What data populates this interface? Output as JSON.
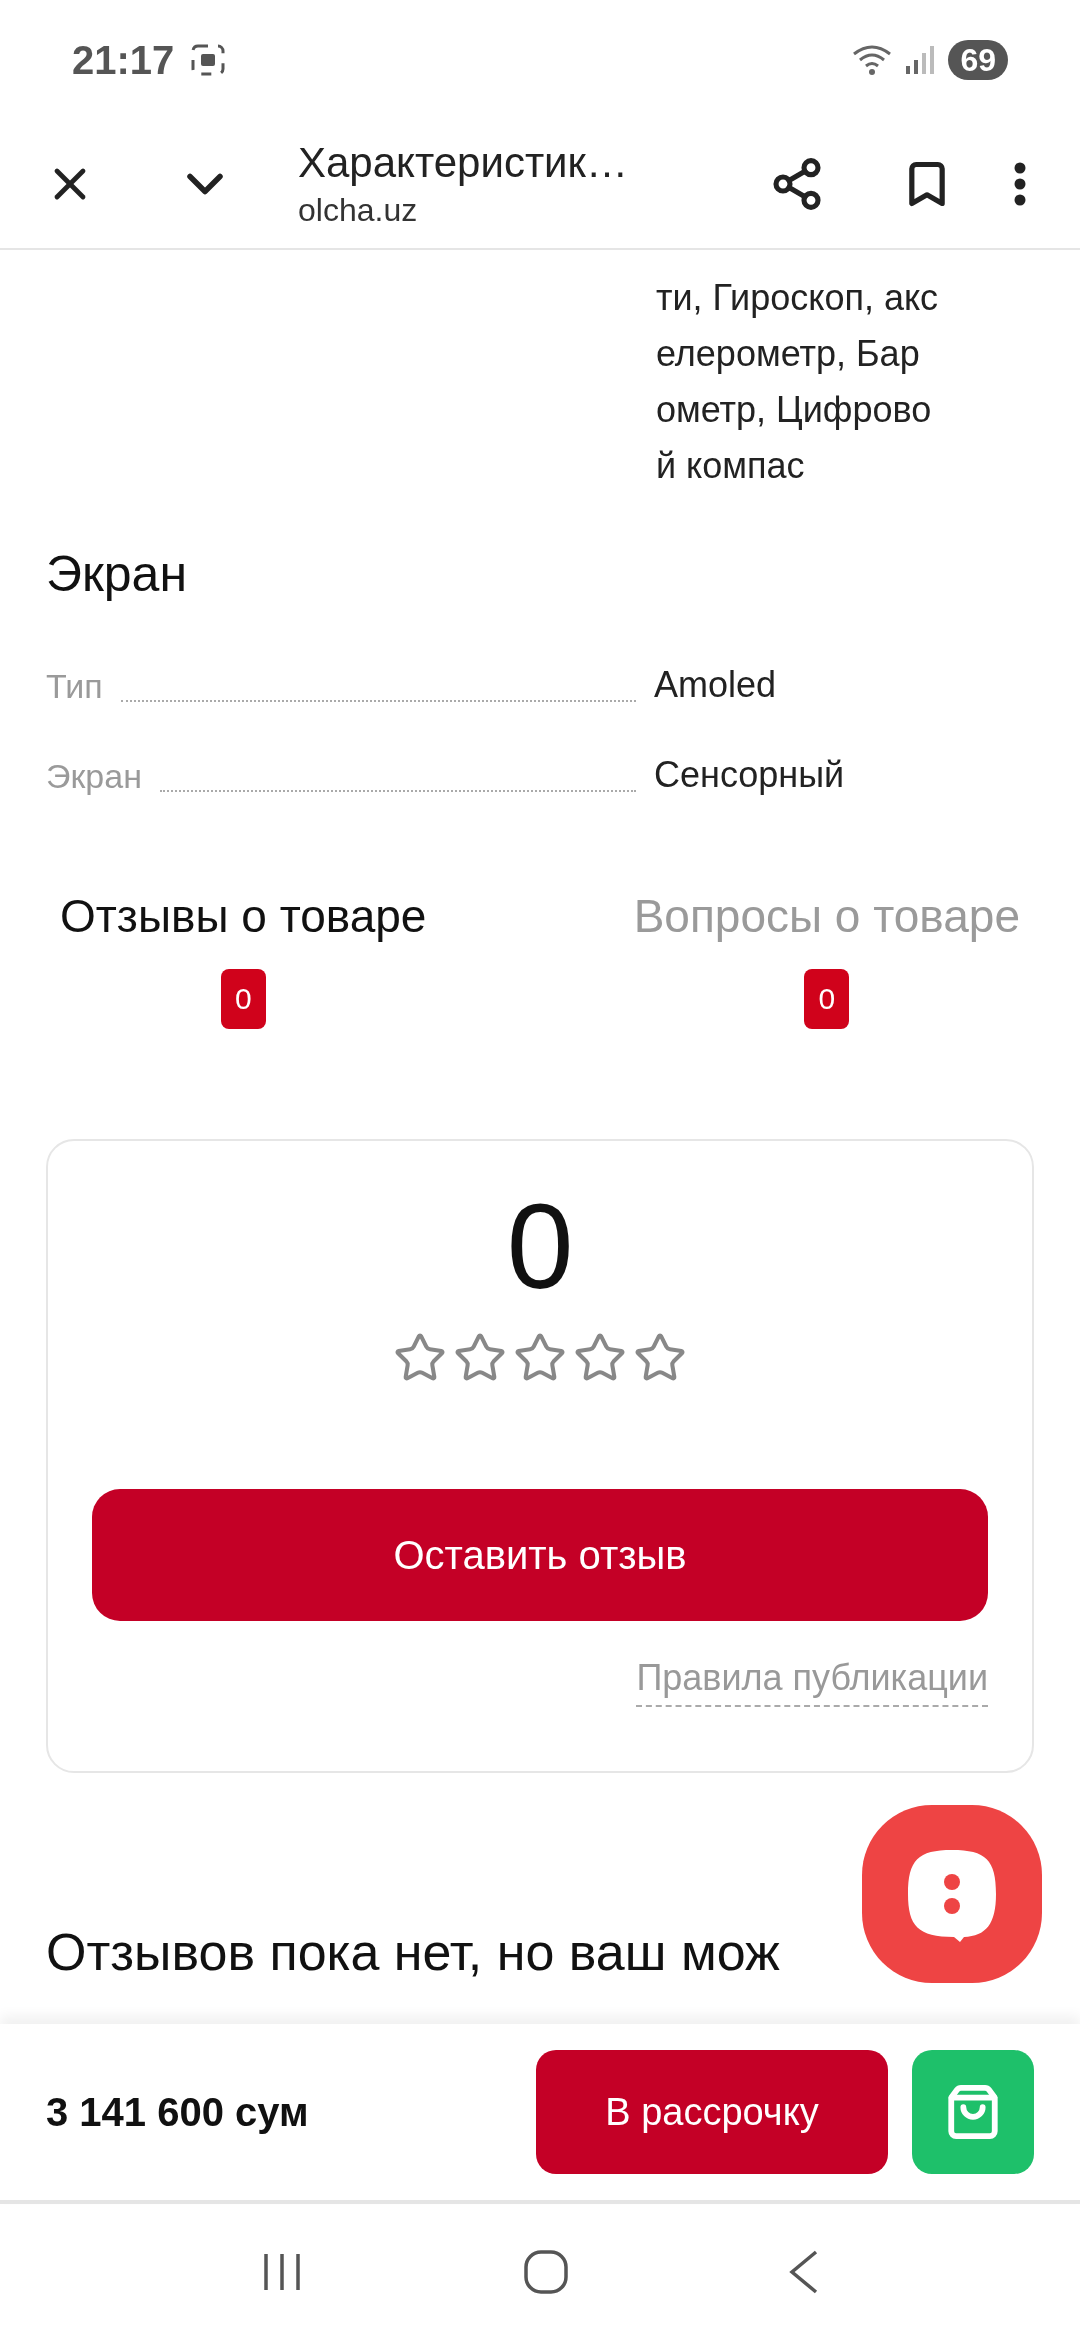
{
  "status_bar": {
    "time": "21:17",
    "battery": "69"
  },
  "browser_bar": {
    "title": "Характеристик…",
    "url": "olcha.uz"
  },
  "spec_continuation": "ти, Гироскоп, акс\nелерометр, Бар\nометр, Цифрово\nй компас",
  "section": {
    "title": "Экран",
    "rows": [
      {
        "label": "Тип",
        "value": "Amoled"
      },
      {
        "label": "Экран",
        "value": "Сенсорный"
      }
    ]
  },
  "tabs": [
    {
      "label": "Отзывы о товаре",
      "count": "0",
      "selected": true
    },
    {
      "label": "Вопросы о товаре",
      "count": "0",
      "selected": false
    }
  ],
  "rating_card": {
    "score": "0",
    "stars": 0,
    "button": "Оставить отзыв",
    "rules_link": "Правила публикации"
  },
  "reviews_heading": "Отзывов пока нет, но ваш мож",
  "bottom_bar": {
    "price": "3 141 600 сум",
    "installment_button": "В рассрочку"
  }
}
